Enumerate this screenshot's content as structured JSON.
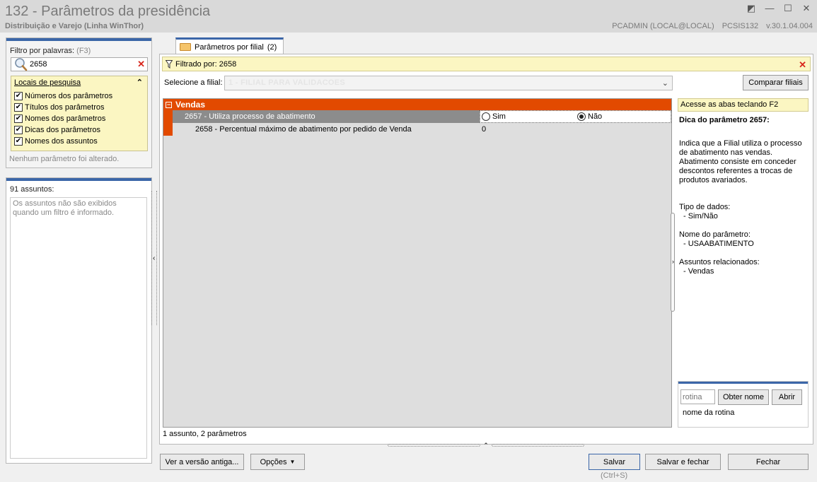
{
  "window": {
    "title": "132 - Parâmetros da presidência",
    "subtitle": "Distribuição e Varejo (Linha WinThor)",
    "user": "PCADMIN (LOCAL@LOCAL)",
    "program": "PCSIS132",
    "version": "v.30.1.04.004"
  },
  "filter": {
    "label": "Filtro por palavras:",
    "shortcut": "(F3)",
    "value": "2658",
    "locais_title": "Locais de pesquisa",
    "locais": [
      {
        "label": "Números dos parâmetros",
        "checked": true
      },
      {
        "label": "Títulos dos parâmetros",
        "checked": true
      },
      {
        "label": "Nomes dos parâmetros",
        "checked": true
      },
      {
        "label": "Dicas dos parâmetros",
        "checked": true
      },
      {
        "label": "Nomes dos assuntos",
        "checked": true
      }
    ],
    "status": "Nenhum parâmetro foi alterado."
  },
  "assuntos": {
    "count_label": "91 assuntos:",
    "note": "Os assuntos não são exibidos quando um filtro é informado."
  },
  "tab": {
    "label": "Parâmetros por filial",
    "count": "(2)"
  },
  "filtrado": {
    "text": "Filtrado por: 2658"
  },
  "filial": {
    "label": "Selecione a filial:",
    "value": "1 - FILIAL PARA VALIDACOES",
    "comparar": "Comparar filiais"
  },
  "grid": {
    "group": "Vendas",
    "rows": [
      {
        "name": "2657 - Utiliza processo de abatimento",
        "options": [
          "Sim",
          "Não"
        ],
        "selected": "Não"
      },
      {
        "name": "2658 - Percentual máximo de abatimento por pedido de Venda",
        "value": "0"
      }
    ],
    "status": "1 assunto, 2 parâmetros"
  },
  "side": {
    "acesse": "Acesse as abas teclando F2",
    "dica_title": "Dica do parâmetro 2657:",
    "dica_body": "Indica que a Filial utiliza o processo de abatimento nas vendas. Abatimento consiste em conceder descontos referentes a trocas de produtos avariados.",
    "tipo_label": "Tipo de dados:",
    "tipo_value": "- Sim/Não",
    "nome_label": "Nome do parâmetro:",
    "nome_value": "- USAABATIMENTO",
    "assuntos_label": "Assuntos relacionados:",
    "assuntos_value": "- Vendas"
  },
  "rotina": {
    "placeholder": "rotina",
    "obter": "Obter nome",
    "abrir": "Abrir",
    "label": "nome da rotina"
  },
  "footer": {
    "versao": "Ver a versão antiga...",
    "opcoes": "Opções",
    "salvar": "Salvar",
    "salvar_shortcut": "(Ctrl+S)",
    "salvar_fechar": "Salvar e fechar",
    "fechar": "Fechar"
  }
}
